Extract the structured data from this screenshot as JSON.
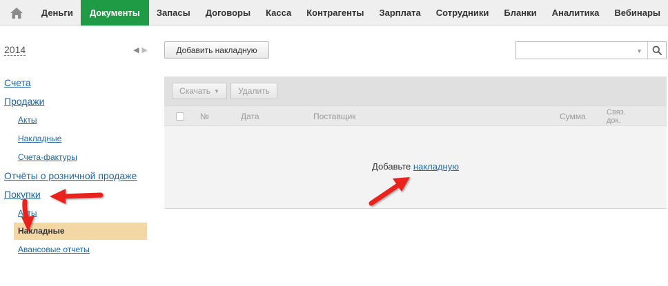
{
  "topnav": {
    "home_icon": "home-icon",
    "items": [
      "Деньги",
      "Документы",
      "Запасы",
      "Договоры",
      "Касса",
      "Контрагенты",
      "Зарплата",
      "Сотрудники",
      "Бланки",
      "Аналитика",
      "Вебинары"
    ],
    "active_index": 1,
    "active_color": "#1f9a45"
  },
  "sidebar": {
    "year": "2014",
    "prev_icon": "triangle-left-icon",
    "next_icon": "triangle-right-icon",
    "sections": {
      "invoices": "Счета",
      "sales": "Продажи",
      "sales_acts": "Акты",
      "sales_waybills": "Накладные",
      "sales_vat_invoices": "Счета-фактуры",
      "retail_reports": "Отчёты о розничной продаже",
      "purchases": "Покупки",
      "purchases_acts": "Акты",
      "purchases_waybills": "Накладные",
      "advance_reports": "Авансовые отчеты"
    },
    "active_item_color": "#f3d8a5"
  },
  "toolbar": {
    "add_button": "Добавить накладную",
    "search_placeholder": "",
    "search_icon": "search-icon"
  },
  "panel": {
    "download_button": "Скачать",
    "delete_button": "Удалить",
    "columns": {
      "number": "№",
      "date": "Дата",
      "supplier": "Поставщик",
      "sum": "Сумма",
      "linked_docs": "Связ. док."
    },
    "empty_prefix": "Добавьте",
    "empty_link": "накладную"
  },
  "annotations": {
    "arrow_color": "#e8211c"
  }
}
